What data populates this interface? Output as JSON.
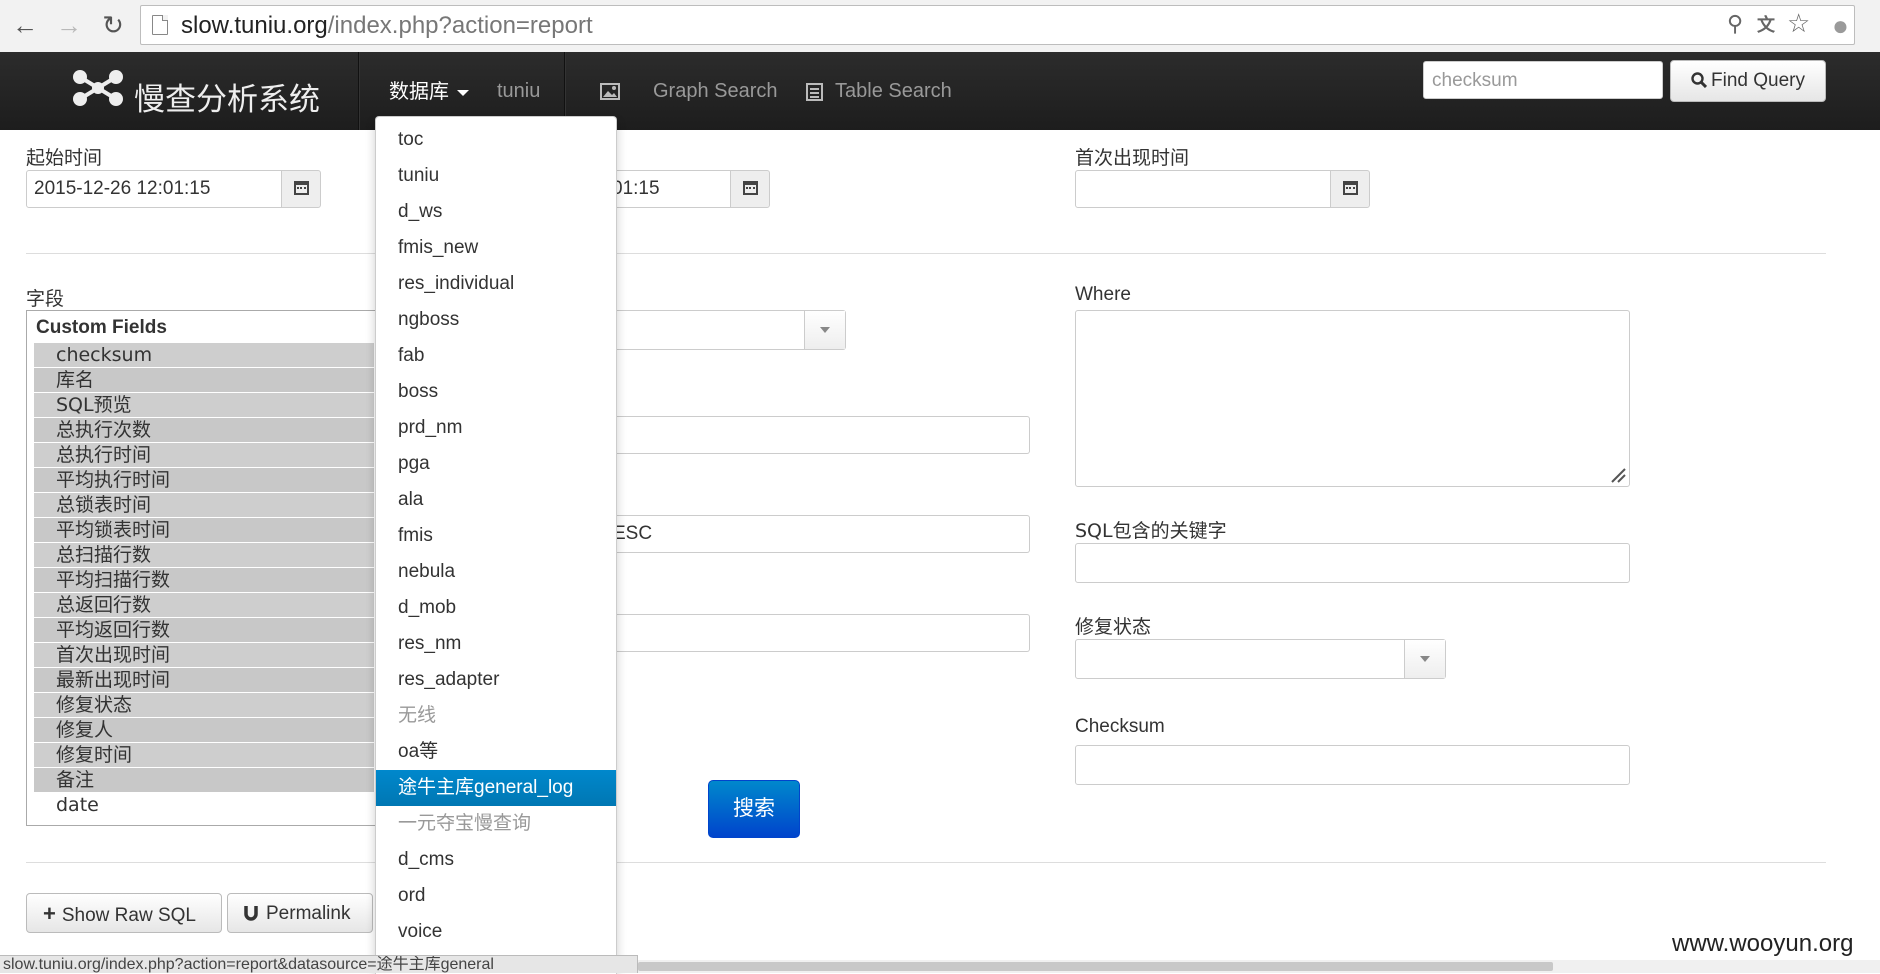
{
  "browser": {
    "url_domain": "slow.tuniu.org",
    "url_path": "/index.php?action=report",
    "status_url": "slow.tuniu.org/index.php?action=report&datasource=途牛主库general"
  },
  "navbar": {
    "brand": "慢查分析系统",
    "db_dropdown": "数据库",
    "current_db": "tuniu",
    "graph_search": "Graph Search",
    "table_search": "Table Search",
    "search_placeholder": "checksum",
    "find_query": "Find Query"
  },
  "form": {
    "start_time_label": "起始时间",
    "start_time_value": "2015-12-26 12:01:15",
    "end_time_partial": "01:15",
    "first_seen_label": "首次出现时间",
    "first_seen_value": "",
    "fields_label": "字段",
    "fields_group": "Custom Fields",
    "fields": [
      {
        "label": "checksum",
        "selected": true
      },
      {
        "label": "库名",
        "selected": true
      },
      {
        "label": "SQL预览",
        "selected": true
      },
      {
        "label": "总执行次数",
        "selected": true
      },
      {
        "label": "总执行时间",
        "selected": true
      },
      {
        "label": "平均执行时间",
        "selected": true
      },
      {
        "label": "总锁表时间",
        "selected": true
      },
      {
        "label": "平均锁表时间",
        "selected": true
      },
      {
        "label": "总扫描行数",
        "selected": true
      },
      {
        "label": "平均扫描行数",
        "selected": true
      },
      {
        "label": "总返回行数",
        "selected": true
      },
      {
        "label": "平均返回行数",
        "selected": true
      },
      {
        "label": "首次出现时间",
        "selected": true
      },
      {
        "label": "最新出现时间",
        "selected": true
      },
      {
        "label": "修复状态",
        "selected": true
      },
      {
        "label": "修复人",
        "selected": true
      },
      {
        "label": "修复时间",
        "selected": true
      },
      {
        "label": "备注",
        "selected": true
      },
      {
        "label": "date",
        "selected": false
      }
    ],
    "order_partial": "ESC",
    "where_label": "Where",
    "sql_keyword_label": "SQL包含的关键字",
    "fix_status_label": "修复状态",
    "checksum_label": "Checksum",
    "search_button": "搜索",
    "show_raw_sql": "Show Raw SQL",
    "permalink": "Permalink"
  },
  "db_menu": [
    {
      "label": "toc",
      "state": "normal"
    },
    {
      "label": "tuniu",
      "state": "normal"
    },
    {
      "label": "d_ws",
      "state": "normal"
    },
    {
      "label": "fmis_new",
      "state": "normal"
    },
    {
      "label": "res_individual",
      "state": "normal"
    },
    {
      "label": "ngboss",
      "state": "normal"
    },
    {
      "label": "fab",
      "state": "normal"
    },
    {
      "label": "boss",
      "state": "normal"
    },
    {
      "label": "prd_nm",
      "state": "normal"
    },
    {
      "label": "pga",
      "state": "normal"
    },
    {
      "label": "ala",
      "state": "normal"
    },
    {
      "label": "fmis",
      "state": "normal"
    },
    {
      "label": "nebula",
      "state": "normal"
    },
    {
      "label": "d_mob",
      "state": "normal"
    },
    {
      "label": "res_nm",
      "state": "normal"
    },
    {
      "label": "res_adapter",
      "state": "normal"
    },
    {
      "label": "无线",
      "state": "dim"
    },
    {
      "label": "oa等",
      "state": "normal"
    },
    {
      "label": "途牛主库general_log",
      "state": "active"
    },
    {
      "label": "一元夺宝慢查询",
      "state": "dim"
    },
    {
      "label": "d_cms",
      "state": "normal"
    },
    {
      "label": "ord",
      "state": "normal"
    },
    {
      "label": "voice",
      "state": "normal"
    }
  ],
  "watermark": "www.wooyun.org"
}
